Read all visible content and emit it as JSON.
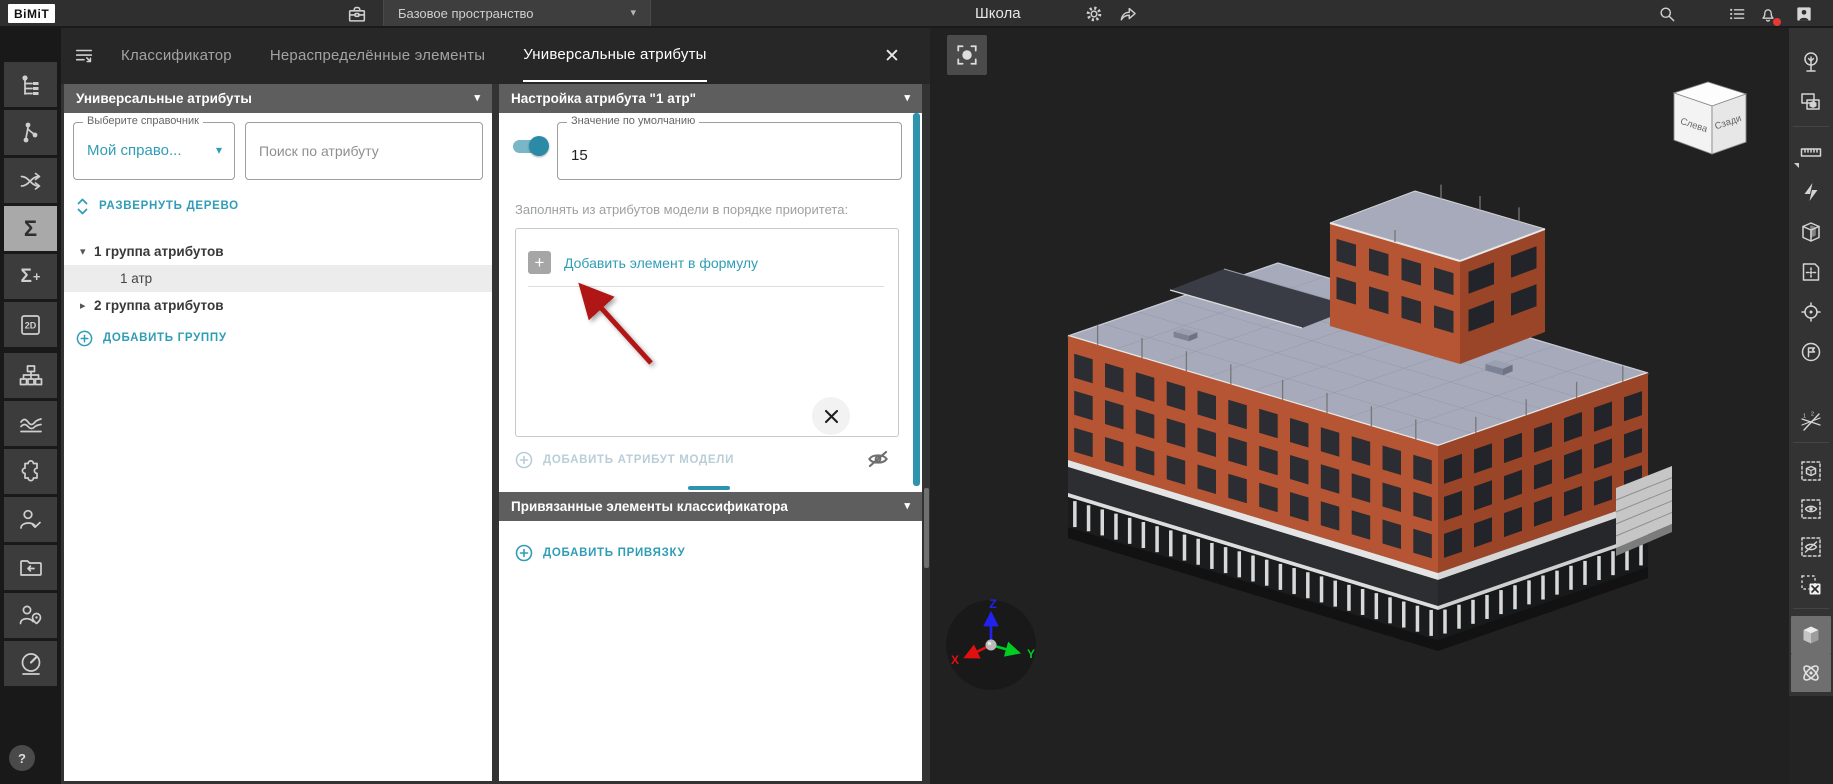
{
  "topbar": {
    "logo": "BiMiT",
    "workspace": "Базовое пространство",
    "title": "Школа"
  },
  "tabs": {
    "classifier": "Классификатор",
    "unallocated": "Нераспределённые элементы",
    "universal": "Универсальные атрибуты"
  },
  "attributes_panel": {
    "header": "Универсальные атрибуты",
    "reference_label": "Выберите справочник",
    "reference_value": "Мой справо...",
    "search_placeholder": "Поиск по атрибуту",
    "expand_tree": "РАЗВЕРНУТЬ ДЕРЕВО",
    "tree": [
      {
        "label": "1 группа атрибутов",
        "state": "expanded"
      },
      {
        "label": "1 атр",
        "state": "selected"
      },
      {
        "label": "2 группа атрибутов",
        "state": "collapsed"
      }
    ],
    "add_group": "ДОБАВИТЬ ГРУППУ"
  },
  "settings_panel": {
    "header": "Настройка атрибута \"1 атр\"",
    "default_value_label": "Значение по умолчанию",
    "default_value": "15",
    "priority_hint": "Заполнять из атрибутов модели в порядке приоритета:",
    "add_formula_element": "Добавить элемент в формулу",
    "add_model_attribute": "ДОБАВИТЬ АТРИБУТ МОДЕЛИ",
    "bound_header": "Привязанные элементы классификатора",
    "add_binding": "ДОБАВИТЬ ПРИВЯЗКУ"
  },
  "viewport": {
    "cube": {
      "left_face": "Слева",
      "back_face": "Сзади"
    },
    "axes": {
      "x": "X",
      "y": "Y",
      "z": "Z"
    }
  },
  "glyphs": {
    "caret_down": "▾",
    "tree_expanded": "▾",
    "tree_collapsed": "▸",
    "close": "✕",
    "plus": "+",
    "sum": "Σ",
    "sum_plus": "+",
    "two_d": "2D",
    "help": "?"
  },
  "colors": {
    "accent": "#2e93ad",
    "annotation_arrow": "#b01212",
    "wall": "#b65534",
    "roof": "#a6aaba"
  }
}
